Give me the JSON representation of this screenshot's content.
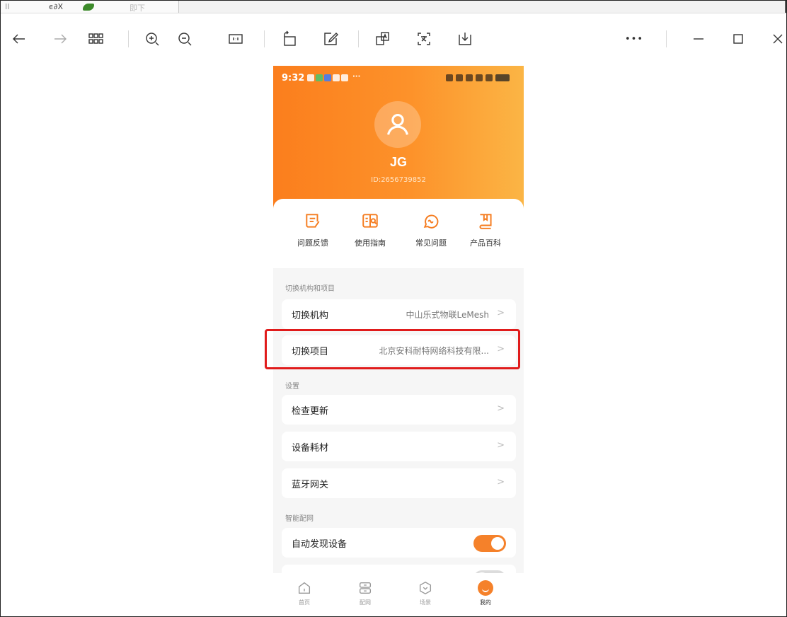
{
  "topstrip": {
    "text_left": "II",
    "text_mid": "ϵ∂X",
    "text_right": "即下"
  },
  "toolbar": {
    "icons": [
      "back-icon",
      "forward-icon",
      "grid-view-icon",
      "zoom-in-icon",
      "zoom-out-icon",
      "actual-size-icon",
      "rotate-icon",
      "edit-icon",
      "ocr-icon",
      "translate-icon",
      "download-icon",
      "more-icon",
      "minimize-icon",
      "maximize-icon",
      "close-icon"
    ],
    "more_label": "•••"
  },
  "phone": {
    "status": {
      "time": "9:32",
      "dots": "···"
    },
    "profile": {
      "name": "JG",
      "id": "ID:2656739852"
    },
    "shortcuts": [
      {
        "label": "问题反馈",
        "icon": "feedback-icon"
      },
      {
        "label": "使用指南",
        "icon": "guide-icon"
      },
      {
        "label": "常见问题",
        "icon": "faq-icon"
      },
      {
        "label": "产品百科",
        "icon": "encyclopedia-icon"
      }
    ],
    "sections": {
      "switch_title": "切换机构和项目",
      "settings_title": "设置",
      "network_title": "智能配网"
    },
    "rows": {
      "switch_org": {
        "label": "切换机构",
        "value": "中山乐式物联LeMesh"
      },
      "switch_project": {
        "label": "切换项目",
        "value": "北京安科耐特网络科技有限..."
      },
      "check_update": {
        "label": "检查更新"
      },
      "device_consumables": {
        "label": "设备耗材"
      },
      "bluetooth_gateway": {
        "label": "蓝牙网关"
      },
      "auto_discover": {
        "label": "自动发现设备",
        "toggle": "on"
      }
    },
    "chevron": ">",
    "tabs": [
      {
        "label": "首页",
        "icon": "home-icon"
      },
      {
        "label": "配网",
        "icon": "network-icon"
      },
      {
        "label": "场景",
        "icon": "scene-icon"
      },
      {
        "label": "我的",
        "icon": "me-icon",
        "active": true
      }
    ],
    "colors": {
      "accent": "#f5812a",
      "header_start": "#fb7e1d",
      "header_end": "#fbb545",
      "highlight": "#e01b1b"
    }
  }
}
